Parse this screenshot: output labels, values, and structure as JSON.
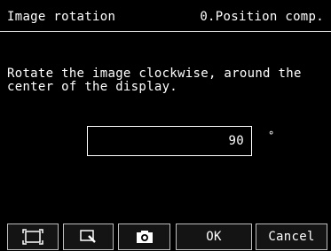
{
  "header": {
    "title": "Image rotation",
    "mode": "0.Position comp."
  },
  "description": "Rotate the image clockwise, around the\ncenter of the display.",
  "rotation": {
    "value": "90",
    "unit": "°"
  },
  "toolbar": {
    "icons": [
      "fit-display-icon",
      "zoom-icon",
      "camera-icon"
    ],
    "ok_label": "OK",
    "cancel_label": "Cancel"
  },
  "colors": {
    "background": "#000000",
    "text": "#ffffff",
    "border": "#bdbdbd"
  }
}
